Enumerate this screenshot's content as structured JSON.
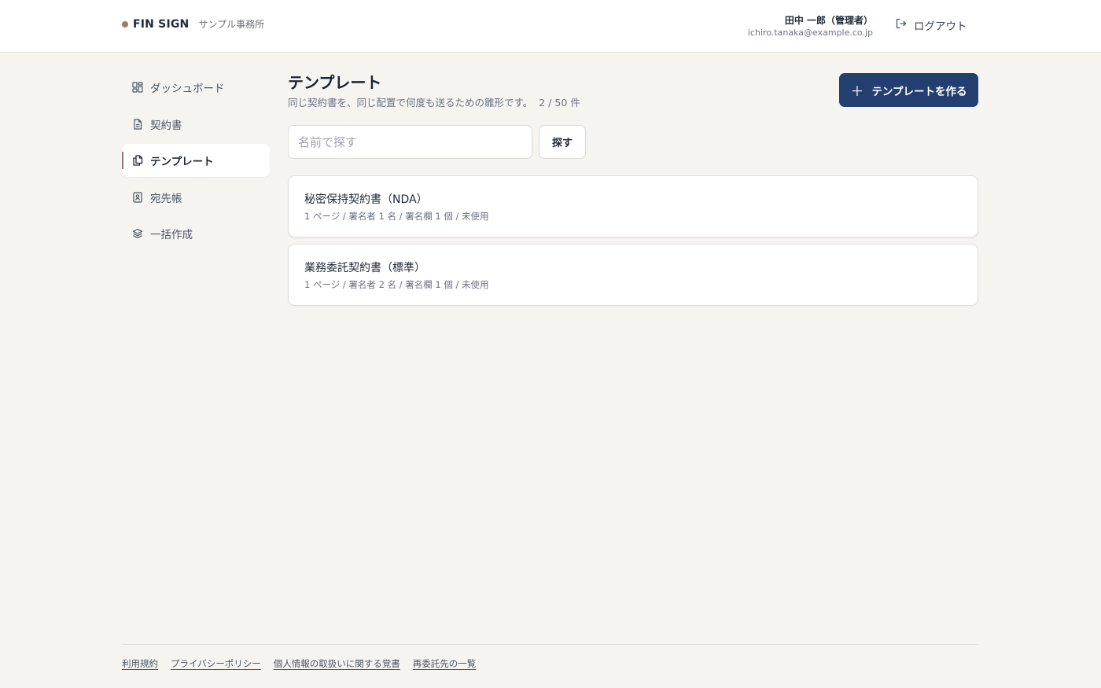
{
  "header": {
    "brand": "FIN SIGN",
    "org": "サンプル事務所",
    "user_name": "田中 一郎（管理者）",
    "user_email": "ichiro.tanaka@example.co.jp",
    "logout_label": "ログアウト"
  },
  "sidebar": {
    "items": [
      {
        "label": "ダッシュボード",
        "icon": "dashboard-icon",
        "active": false
      },
      {
        "label": "契約書",
        "icon": "document-icon",
        "active": false
      },
      {
        "label": "テンプレート",
        "icon": "copy-icon",
        "active": true
      },
      {
        "label": "宛先帳",
        "icon": "contact-book-icon",
        "active": false
      },
      {
        "label": "一括作成",
        "icon": "layers-icon",
        "active": false
      }
    ]
  },
  "main": {
    "title": "テンプレート",
    "subtitle": "同じ契約書を、同じ配置で何度も送るための雛形です。",
    "count": "2 / 50 件",
    "create_label": "テンプレートを作る",
    "search_placeholder": "名前で探す",
    "search_value": "",
    "search_button": "探す",
    "templates": [
      {
        "title": "秘密保持契約書（NDA）",
        "meta": "1 ページ / 署名者 1 名 / 署名欄 1 個 / 未使用"
      },
      {
        "title": "業務委託契約書（標準）",
        "meta": "1 ページ / 署名者 2 名 / 署名欄 1 個 / 未使用"
      }
    ]
  },
  "footer": {
    "links": [
      "利用規約",
      "プライバシーポリシー",
      "個人情報の取扱いに関する覚書",
      "再委託先の一覧"
    ]
  },
  "colors": {
    "accent": "#233f70",
    "brand_dot": "#9a7b6b",
    "background": "#f5f4f1"
  }
}
